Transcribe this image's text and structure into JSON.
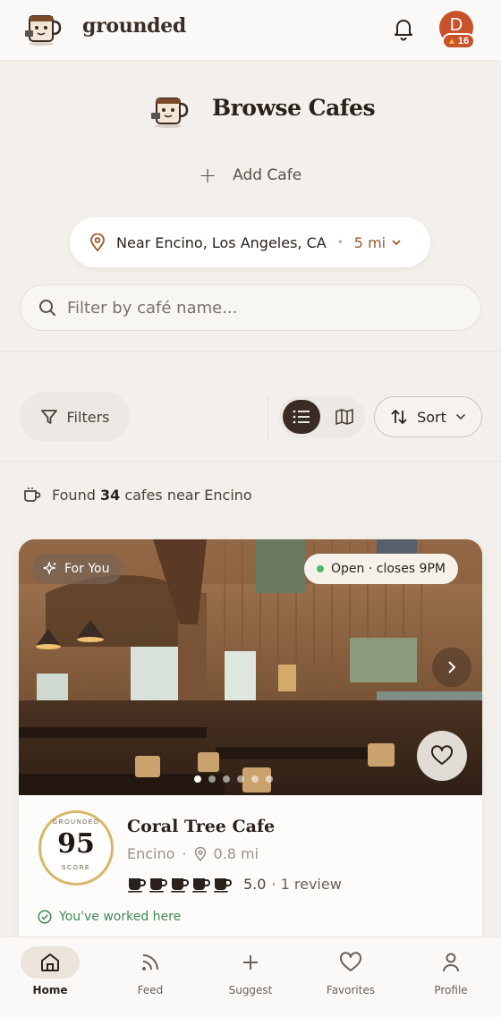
{
  "app": {
    "brand": "grounded",
    "avatar_initial": "D",
    "streak_count": "16"
  },
  "header": {
    "title": "Browse Cafes",
    "add_cafe_label": "Add Cafe"
  },
  "location": {
    "place": "Near Encino, Los Angeles, CA",
    "separator": "•",
    "radius": "5 mi"
  },
  "search": {
    "placeholder": "Filter by café name..."
  },
  "toolbar": {
    "filters_label": "Filters",
    "sort_label": "Sort",
    "active_view": "list"
  },
  "results": {
    "prefix": "Found",
    "count": "34",
    "suffix": "cafes near Encino"
  },
  "cafe_card": {
    "badge_for_you": "For You",
    "open_status": "Open · closes 9PM",
    "photo_count": 6,
    "photo_index": 1,
    "score_top": "GROUNDED",
    "score_value": "95",
    "score_bottom": "SCORE",
    "name": "Coral Tree Cafe",
    "neighborhood": "Encino",
    "meta_separator": "·",
    "distance": "0.8 mi",
    "rating_cups": 5,
    "rating": "5.0",
    "reviews": "· 1 review",
    "worked_here": "You've worked here"
  },
  "bottom_nav": {
    "items": [
      {
        "label": "Home",
        "icon": "home-icon",
        "active": true
      },
      {
        "label": "Feed",
        "icon": "feed-icon",
        "active": false
      },
      {
        "label": "Suggest",
        "icon": "plus-icon",
        "active": false
      },
      {
        "label": "Favorites",
        "icon": "heart-icon",
        "active": false
      },
      {
        "label": "Profile",
        "icon": "person-icon",
        "active": false
      }
    ]
  },
  "colors": {
    "accent": "#c8522a",
    "dark": "#3a2c24",
    "open_green": "#4cba6e",
    "score_gold": "#d6b86a"
  }
}
